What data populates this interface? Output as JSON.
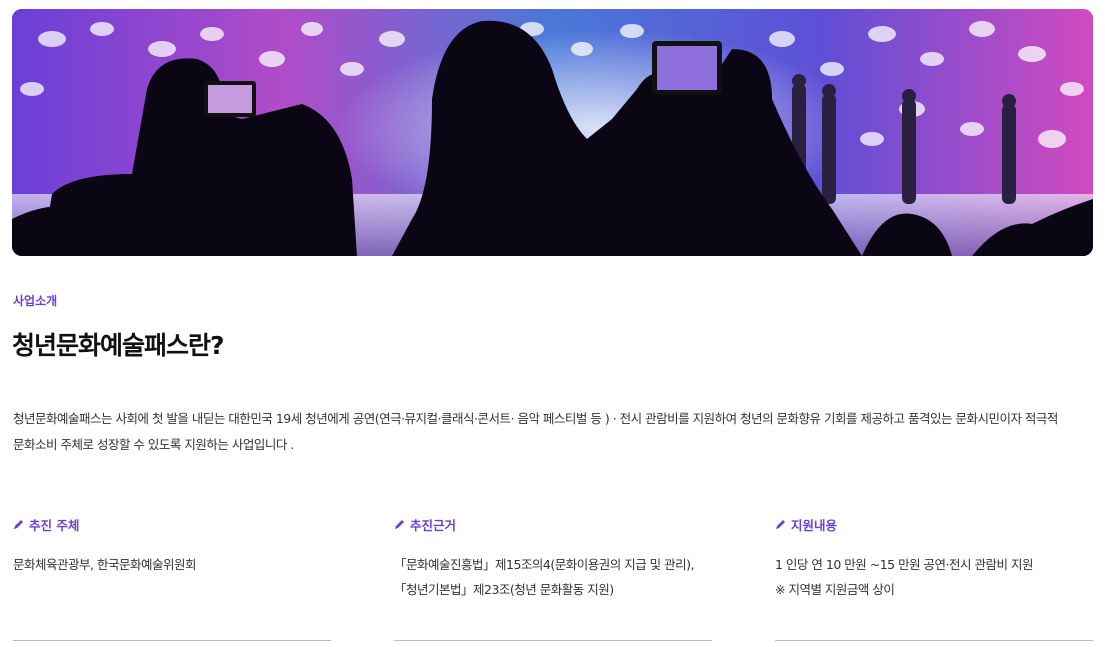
{
  "section": {
    "eyebrow": "사업소개",
    "title": "청년문화예술패스란?"
  },
  "description": {
    "line1": "청년문화예술패스는 사회에 첫 발을 내딛는 대한민국 19세 청년에게 공연(연극·뮤지컬·클래식·콘서트· 음악 페스티벌 등 ) · 전시 관람비를 지원하여 청년의 문화향유 기회를 제공하고 품격있는 문화시민이자 적극적",
    "line2": "문화소비 주체로 성장할 수 있도록 지원하는 사업입니다 ."
  },
  "columns": [
    {
      "label": "추진 주체",
      "icon": "pencil-icon",
      "lines": [
        "문화체육관광부, 한국문화예술위원회"
      ]
    },
    {
      "label": "추진근거",
      "icon": "pencil-icon",
      "lines": [
        "「문화예술진흥법」제15조의4(문화이용권의 지급 및 관리),",
        "「청년기본법」제23조(청년 문화활동 지원)"
      ]
    },
    {
      "label": "지원내용",
      "icon": "pencil-icon",
      "lines": [
        "1 인당 연 10 만원 ~15 만원 공연·전시 관람비 지원",
        "※ 지역별 지원금액 상이"
      ]
    }
  ],
  "colors": {
    "accent": "#6b3fd4",
    "rule": "#bdbdbd"
  }
}
